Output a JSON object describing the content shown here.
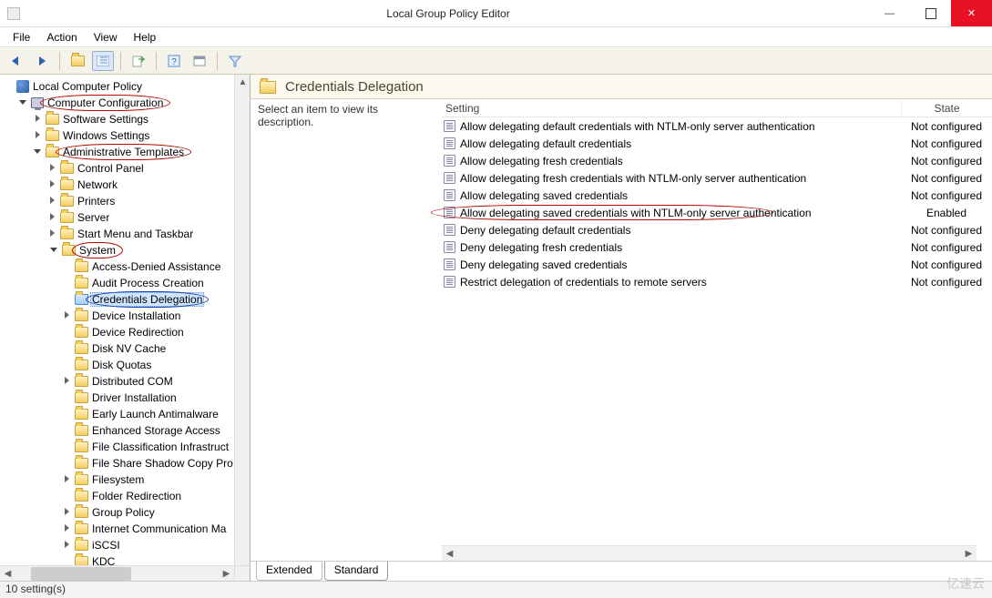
{
  "window": {
    "title": "Local Group Policy Editor"
  },
  "menubar": [
    "File",
    "Action",
    "View",
    "Help"
  ],
  "tree": {
    "root": "Local Computer Policy",
    "computer_configuration": "Computer Configuration",
    "software_settings": "Software Settings",
    "windows_settings": "Windows Settings",
    "administrative_templates": "Administrative Templates",
    "admin_children": [
      "Control Panel",
      "Network",
      "Printers",
      "Server",
      "Start Menu and Taskbar"
    ],
    "system": "System",
    "system_children": [
      "Access-Denied Assistance",
      "Audit Process Creation",
      "Credentials Delegation",
      "Device Installation",
      "Device Redirection",
      "Disk NV Cache",
      "Disk Quotas",
      "Distributed COM",
      "Driver Installation",
      "Early Launch Antimalware",
      "Enhanced Storage Access",
      "File Classification Infrastruct",
      "File Share Shadow Copy Pro",
      "Filesystem",
      "Folder Redirection",
      "Group Policy",
      "Internet Communication Ma",
      "iSCSI",
      "KDC"
    ]
  },
  "right": {
    "title": "Credentials Delegation",
    "desc_prompt": "Select an item to view its description.",
    "columns": {
      "setting": "Setting",
      "state": "State"
    },
    "settings": [
      {
        "name": "Allow delegating default credentials with NTLM-only server authentication",
        "state": "Not configured"
      },
      {
        "name": "Allow delegating default credentials",
        "state": "Not configured"
      },
      {
        "name": "Allow delegating fresh credentials",
        "state": "Not configured"
      },
      {
        "name": "Allow delegating fresh credentials with NTLM-only server authentication",
        "state": "Not configured"
      },
      {
        "name": "Allow delegating saved credentials",
        "state": "Not configured"
      },
      {
        "name": "Allow delegating saved credentials with NTLM-only server authentication",
        "state": "Enabled"
      },
      {
        "name": "Deny delegating default credentials",
        "state": "Not configured"
      },
      {
        "name": "Deny delegating fresh credentials",
        "state": "Not configured"
      },
      {
        "name": "Deny delegating saved credentials",
        "state": "Not configured"
      },
      {
        "name": "Restrict delegation of credentials to remote servers",
        "state": "Not configured"
      }
    ],
    "tabs": {
      "extended": "Extended",
      "standard": "Standard"
    }
  },
  "status": "10 setting(s)",
  "watermark": "亿速云"
}
